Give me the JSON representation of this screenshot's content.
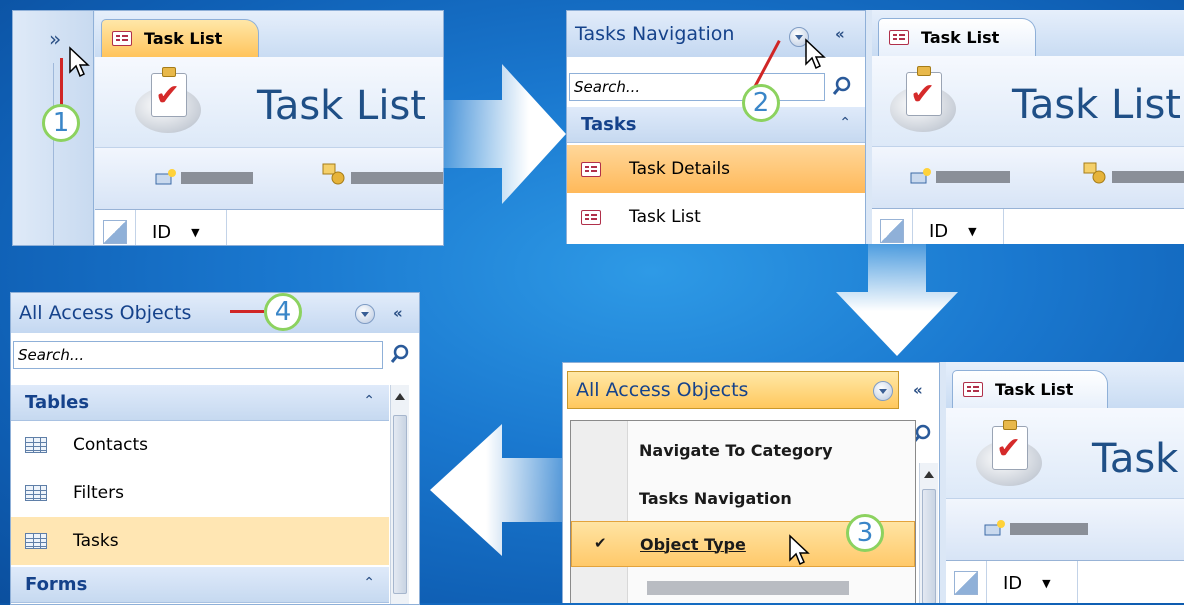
{
  "step1": {
    "expand_glyph": "»",
    "tab_label": "Task List",
    "header_title": "Task List",
    "grid_column": "ID",
    "step_number": "1"
  },
  "step2": {
    "pane_title": "Tasks Navigation",
    "collapse_glyph": "«",
    "search_placeholder": "Search...",
    "group_label": "Tasks",
    "group_collapse_glyph": "⌃",
    "items": [
      {
        "label": "Task Details",
        "selected": true
      },
      {
        "label": "Task List",
        "selected": false
      }
    ],
    "tab_label": "Task List",
    "header_title": "Task List",
    "grid_column": "ID",
    "step_number": "2"
  },
  "step3": {
    "pane_title": "All Access Objects",
    "collapse_glyph": "«",
    "menu_items": [
      {
        "label": "Navigate To Category",
        "checked": false
      },
      {
        "label": "Tasks Navigation",
        "checked": false
      },
      {
        "label": "Object Type",
        "checked": true
      }
    ],
    "check_glyph": "✔",
    "tab_label": "Task List",
    "header_title": "Task",
    "grid_column": "ID",
    "step_number": "3"
  },
  "step4": {
    "pane_title": "All Access Objects",
    "collapse_glyph": "«",
    "search_placeholder": "Search...",
    "groups": [
      {
        "label": "Tables",
        "items": [
          "Contacts",
          "Filters",
          "Tasks"
        ]
      },
      {
        "label": "Forms",
        "items": []
      }
    ],
    "highlighted_item": "Tasks",
    "group_collapse_glyph": "⌃",
    "step_number": "4"
  },
  "colors": {
    "background": "#1a78cf",
    "highlight": "#ffc45c",
    "callout_ring": "#8cd25f",
    "callout_text": "#3a86c8",
    "callout_line": "#d02626"
  }
}
